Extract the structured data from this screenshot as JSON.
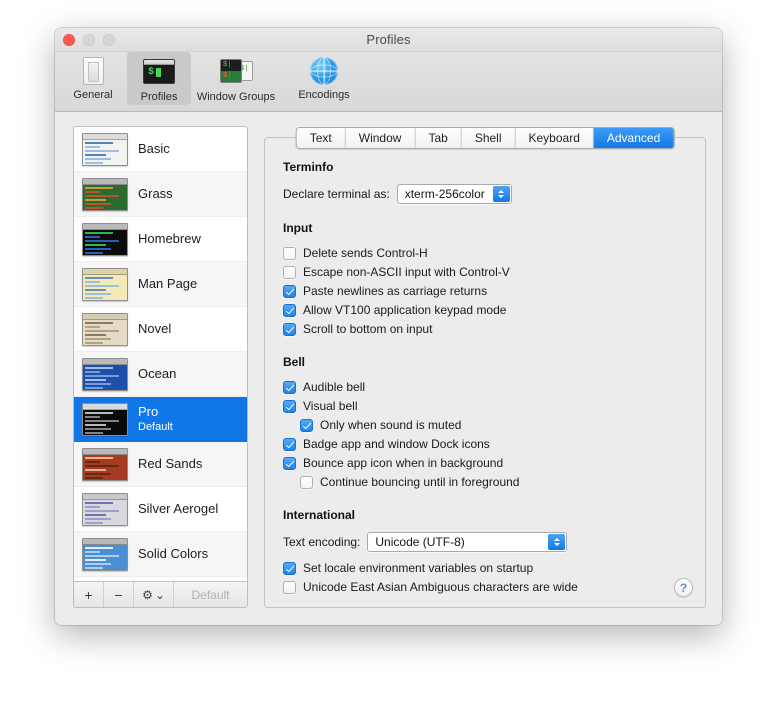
{
  "window": {
    "title": "Profiles",
    "traffic_lights": [
      "close-button",
      "minimize-button",
      "zoom-button"
    ]
  },
  "toolbar": {
    "items": [
      {
        "label": "General",
        "icon": "general-icon",
        "selected": false
      },
      {
        "label": "Profiles",
        "icon": "profiles-icon",
        "selected": true
      },
      {
        "label": "Window Groups",
        "icon": "window-groups-icon",
        "selected": false
      },
      {
        "label": "Encodings",
        "icon": "encodings-globe-icon",
        "selected": false
      }
    ]
  },
  "profiles": {
    "items": [
      {
        "name": "Basic",
        "sub": "",
        "selected": false,
        "bg": "#f2f2f0",
        "bar": "#dcdcdc",
        "fg": "#3b6ea8",
        "accent": "#8fb5dc"
      },
      {
        "name": "Grass",
        "sub": "",
        "selected": false,
        "bg": "#2c6b2f",
        "bar": "#b9b9b9",
        "fg": "#e2a33a",
        "accent": "#d4512a"
      },
      {
        "name": "Homebrew",
        "sub": "",
        "selected": false,
        "bg": "#0b0b0b",
        "bar": "#b9b9b9",
        "fg": "#2ad94a",
        "accent": "#2f6ed6"
      },
      {
        "name": "Man Page",
        "sub": "",
        "selected": false,
        "bg": "#f4e9b8",
        "bar": "#ddd3a4",
        "fg": "#4d7fb8",
        "accent": "#8fb5dc"
      },
      {
        "name": "Novel",
        "sub": "",
        "selected": false,
        "bg": "#e5dcc8",
        "bar": "#d6cdb8",
        "fg": "#7a6a50",
        "accent": "#a89878"
      },
      {
        "name": "Ocean",
        "sub": "",
        "selected": false,
        "bg": "#1f4ea8",
        "bar": "#b9b9b9",
        "fg": "#bcd4f0",
        "accent": "#7fb0e8"
      },
      {
        "name": "Pro",
        "sub": "Default",
        "selected": true,
        "bg": "#0a0a0a",
        "bar": "#d8d8d8",
        "fg": "#d8d8d8",
        "accent": "#9a9a9a"
      },
      {
        "name": "Red Sands",
        "sub": "",
        "selected": false,
        "bg": "#a63a23",
        "bar": "#b9b9b9",
        "fg": "#f0c890",
        "accent": "#5a2414"
      },
      {
        "name": "Silver Aerogel",
        "sub": "",
        "selected": false,
        "bg": "#d9d9dd",
        "bar": "#c8c8cc",
        "fg": "#5a5fa8",
        "accent": "#9096c8"
      },
      {
        "name": "Solid Colors",
        "sub": "",
        "selected": false,
        "bg": "#4a8fd4",
        "bar": "#b9b9b9",
        "fg": "#ffffff",
        "accent": "#bcd8f2"
      }
    ],
    "toolbar": {
      "add_label": "+",
      "remove_label": "−",
      "gear_label": "⚙",
      "gear_chevron": "⌄",
      "default_label": "Default"
    }
  },
  "tabs": [
    {
      "label": "Text",
      "active": false
    },
    {
      "label": "Window",
      "active": false
    },
    {
      "label": "Tab",
      "active": false
    },
    {
      "label": "Shell",
      "active": false
    },
    {
      "label": "Keyboard",
      "active": false
    },
    {
      "label": "Advanced",
      "active": true
    }
  ],
  "advanced": {
    "terminfo": {
      "title": "Terminfo",
      "declare_label": "Declare terminal as:",
      "declare_value": "xterm-256color"
    },
    "input": {
      "title": "Input",
      "options": [
        {
          "label": "Delete sends Control-H",
          "checked": false,
          "indent": false
        },
        {
          "label": "Escape non-ASCII input with Control-V",
          "checked": false,
          "indent": false
        },
        {
          "label": "Paste newlines as carriage returns",
          "checked": true,
          "indent": false
        },
        {
          "label": "Allow VT100 application keypad mode",
          "checked": true,
          "indent": false
        },
        {
          "label": "Scroll to bottom on input",
          "checked": true,
          "indent": false
        }
      ]
    },
    "bell": {
      "title": "Bell",
      "options": [
        {
          "label": "Audible bell",
          "checked": true,
          "indent": false
        },
        {
          "label": "Visual bell",
          "checked": true,
          "indent": false
        },
        {
          "label": "Only when sound is muted",
          "checked": true,
          "indent": true
        },
        {
          "label": "Badge app and window Dock icons",
          "checked": true,
          "indent": false
        },
        {
          "label": "Bounce app icon when in background",
          "checked": true,
          "indent": false
        },
        {
          "label": "Continue bouncing until in foreground",
          "checked": false,
          "indent": true
        }
      ]
    },
    "international": {
      "title": "International",
      "encoding_label": "Text encoding:",
      "encoding_value": "Unicode (UTF-8)",
      "options": [
        {
          "label": "Set locale environment variables on startup",
          "checked": true,
          "indent": false
        },
        {
          "label": "Unicode East Asian Ambiguous characters are wide",
          "checked": false,
          "indent": false
        }
      ]
    },
    "help_label": "?"
  },
  "colors": {
    "selection_blue": "#1277e6",
    "checkbox_blue": "#1e84ea",
    "window_bg": "#ececec",
    "close_red": "#fb5a52"
  }
}
